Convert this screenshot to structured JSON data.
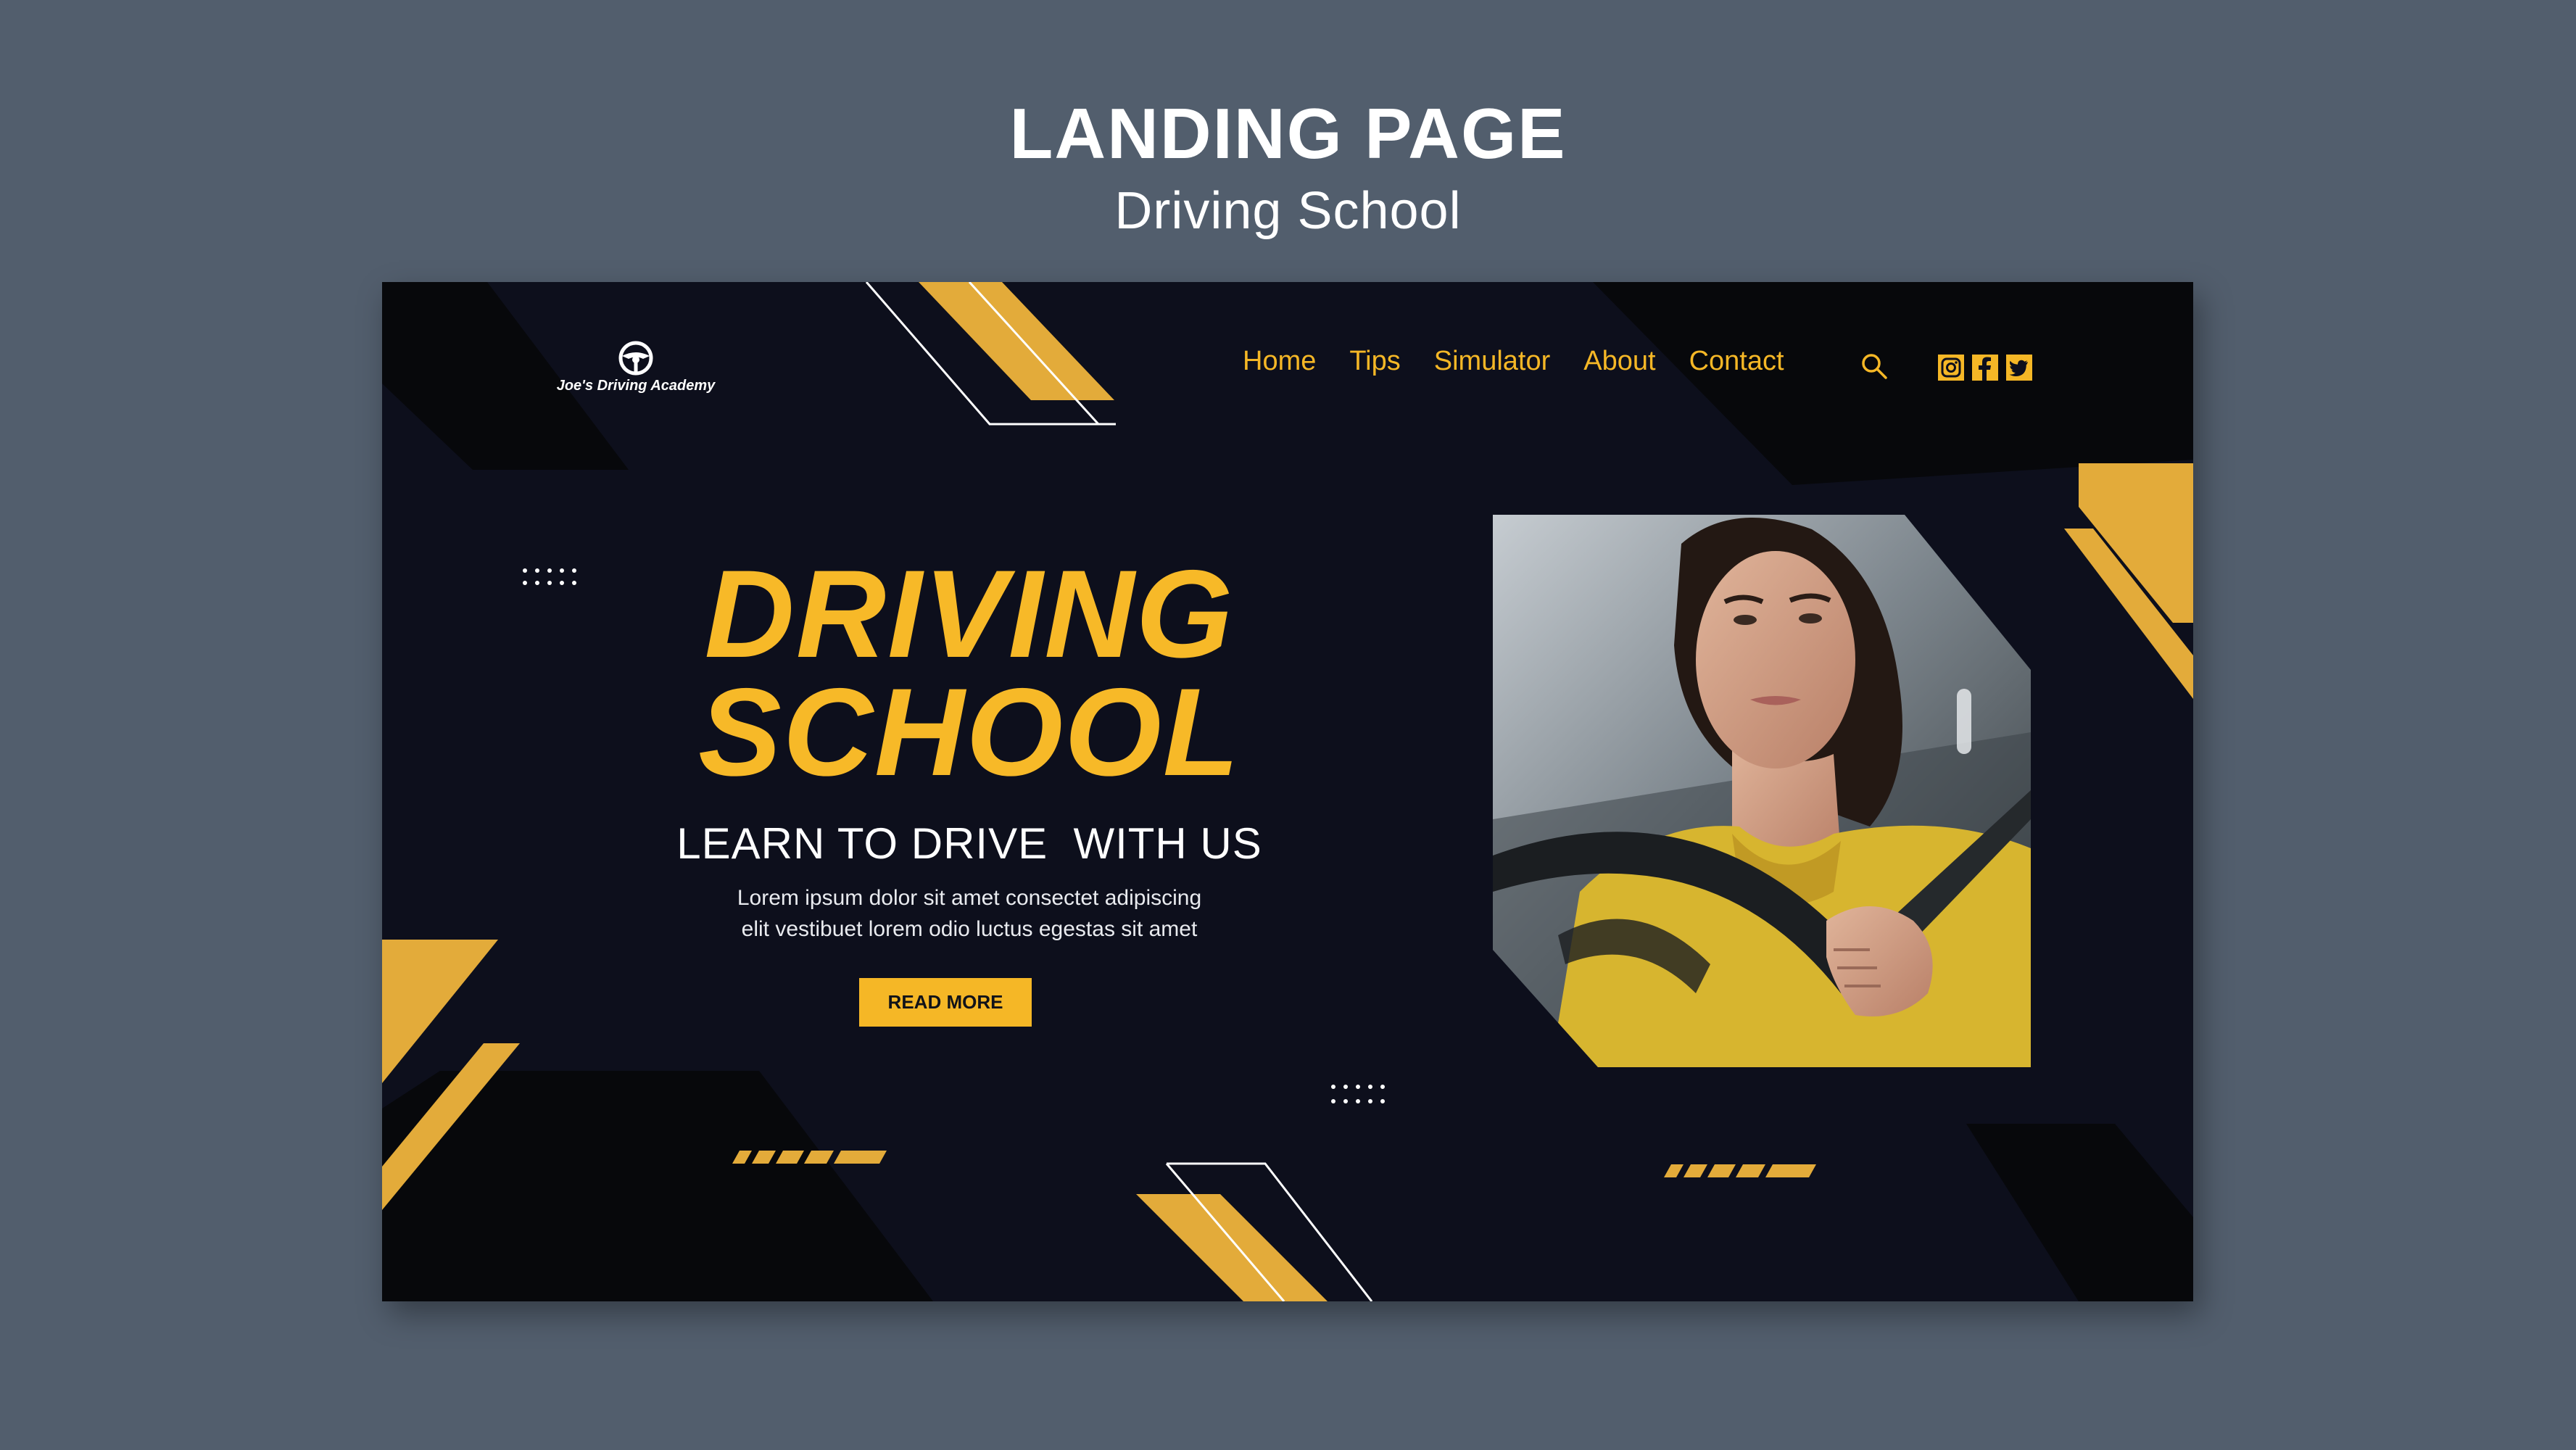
{
  "presentation": {
    "title": "LANDING PAGE",
    "subtitle": "Driving School"
  },
  "site": {
    "brand": "Joe's Driving Academy",
    "nav": {
      "items": [
        {
          "label": "Home"
        },
        {
          "label": "Tips"
        },
        {
          "label": "Simulator"
        },
        {
          "label": "About"
        },
        {
          "label": "Contact"
        }
      ],
      "search_icon": "search-icon",
      "social_icons": [
        "instagram-icon",
        "facebook-icon",
        "twitter-icon"
      ]
    },
    "hero": {
      "headline_line1": "DRIVING",
      "headline_line2": "SCHOOL",
      "subheadline": "LEARN TO DRIVE  WITH US",
      "body_line1": "Lorem ipsum dolor sit amet consectet adipiscing",
      "body_line2": "elit vestibuet lorem odio luctus egestas sit amet",
      "cta_label": "READ MORE"
    }
  },
  "colors": {
    "page_background": "#525e6d",
    "mockup_background": "#0d0f1c",
    "accent_yellow": "#f5b726",
    "black_shape": "#07080b",
    "text_white": "#ffffff"
  }
}
